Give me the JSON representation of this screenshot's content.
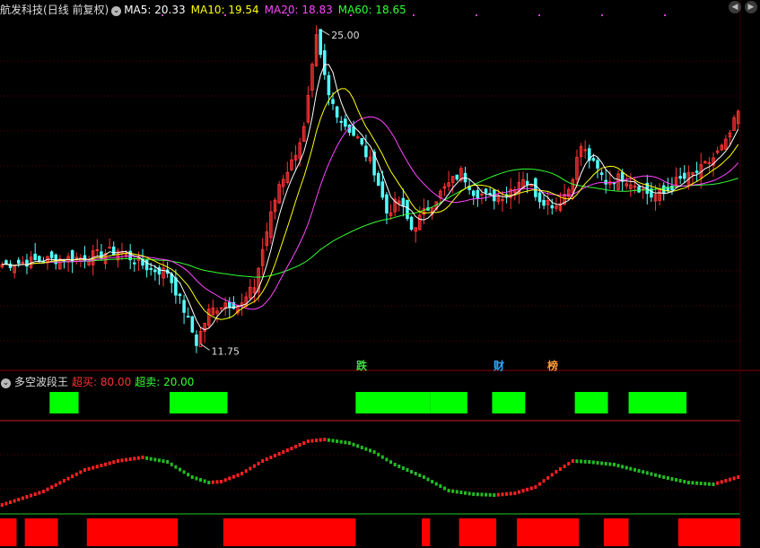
{
  "header": {
    "stock_name": "航发科技",
    "period": "(日线 前复权)",
    "ma": [
      {
        "label": "MA5: 20.33",
        "color": "#ffffff"
      },
      {
        "label": "MA10: 19.54",
        "color": "#ffff00"
      },
      {
        "label": "MA20: 18.83",
        "color": "#ff44ff"
      },
      {
        "label": "MA60: 18.65",
        "color": "#33ff33"
      }
    ],
    "nav_prev_icon": "◀",
    "nav_next_icon": "▶"
  },
  "indicator": {
    "name": "多空波段王",
    "overbuy_label": "超买: 80.00",
    "oversell_label": "超卖: 20.00"
  },
  "events": [
    {
      "label": "跌",
      "color": "#44dd44"
    },
    {
      "label": "财",
      "color": "#33aaff"
    },
    {
      "label": "榜",
      "color": "#ff9933"
    }
  ],
  "chart_data": {
    "type": "candlestick",
    "price_high_label": "25.00",
    "price_low_label": "11.75",
    "price_high": 25.0,
    "price_low": 11.75,
    "ylim": [
      11.2,
      25.5
    ],
    "ma_colors": {
      "ma5": "#ffffff",
      "ma10": "#ffff00",
      "ma20": "#ff44ff",
      "ma60": "#33ff33"
    },
    "up_color": "#ff3333",
    "down_color": "#55ffff",
    "close_waypoints": [
      [
        0,
        15.1
      ],
      [
        10,
        15.3
      ],
      [
        20,
        15.4
      ],
      [
        28,
        15.7
      ],
      [
        32,
        15.3
      ],
      [
        36,
        14.9
      ],
      [
        40,
        14.8
      ],
      [
        44,
        13.2
      ],
      [
        47,
        11.8
      ],
      [
        50,
        13.1
      ],
      [
        54,
        13.5
      ],
      [
        58,
        13.4
      ],
      [
        61,
        14.2
      ],
      [
        64,
        16.5
      ],
      [
        67,
        18.5
      ],
      [
        70,
        19.4
      ],
      [
        73,
        20.8
      ],
      [
        76,
        24.6
      ],
      [
        79,
        22.2
      ],
      [
        82,
        21.2
      ],
      [
        86,
        20.4
      ],
      [
        90,
        19.1
      ],
      [
        93,
        17.3
      ],
      [
        96,
        17.8
      ],
      [
        99,
        16.6
      ],
      [
        103,
        17.5
      ],
      [
        107,
        18.3
      ],
      [
        111,
        19.0
      ],
      [
        114,
        18.2
      ],
      [
        118,
        17.9
      ],
      [
        122,
        18.1
      ],
      [
        126,
        18.8
      ],
      [
        130,
        17.9
      ],
      [
        134,
        17.6
      ],
      [
        137,
        18.3
      ],
      [
        140,
        20.1
      ],
      [
        143,
        19.3
      ],
      [
        146,
        18.6
      ],
      [
        150,
        18.8
      ],
      [
        153,
        18.5
      ],
      [
        157,
        18.0
      ],
      [
        160,
        18.1
      ],
      [
        163,
        18.6
      ],
      [
        166,
        18.8
      ],
      [
        169,
        19.1
      ],
      [
        172,
        19.6
      ],
      [
        175,
        20.2
      ],
      [
        178,
        21.5
      ]
    ],
    "wave_indicator": {
      "range": [
        0,
        100
      ],
      "overbought": 80,
      "oversold": 20,
      "points": [
        [
          0,
          9
        ],
        [
          10,
          24
        ],
        [
          20,
          48
        ],
        [
          28,
          58
        ],
        [
          34,
          62
        ],
        [
          40,
          57
        ],
        [
          46,
          40
        ],
        [
          50,
          34
        ],
        [
          53,
          35
        ],
        [
          58,
          44
        ],
        [
          63,
          58
        ],
        [
          69,
          70
        ],
        [
          74,
          80
        ],
        [
          78,
          82
        ],
        [
          84,
          78
        ],
        [
          90,
          68
        ],
        [
          95,
          54
        ],
        [
          102,
          40
        ],
        [
          108,
          25
        ],
        [
          114,
          21
        ],
        [
          119,
          20
        ],
        [
          124,
          22
        ],
        [
          129,
          29
        ],
        [
          134,
          46
        ],
        [
          138,
          58
        ],
        [
          142,
          57
        ],
        [
          148,
          54
        ],
        [
          154,
          47
        ],
        [
          160,
          40
        ],
        [
          166,
          34
        ],
        [
          172,
          32
        ],
        [
          178,
          40
        ]
      ]
    },
    "bull_bear_zones": [
      [
        12,
        18
      ],
      [
        41,
        54
      ],
      [
        86,
        103
      ],
      [
        104,
        112
      ],
      [
        119,
        126
      ],
      [
        139,
        146
      ],
      [
        152,
        165
      ]
    ],
    "bottom_blocks": [
      [
        0,
        3
      ],
      [
        6,
        13
      ],
      [
        21,
        42
      ],
      [
        54,
        85
      ],
      [
        102,
        103
      ],
      [
        111,
        119
      ],
      [
        125,
        139
      ],
      [
        146,
        151
      ],
      [
        164,
        178
      ]
    ]
  }
}
